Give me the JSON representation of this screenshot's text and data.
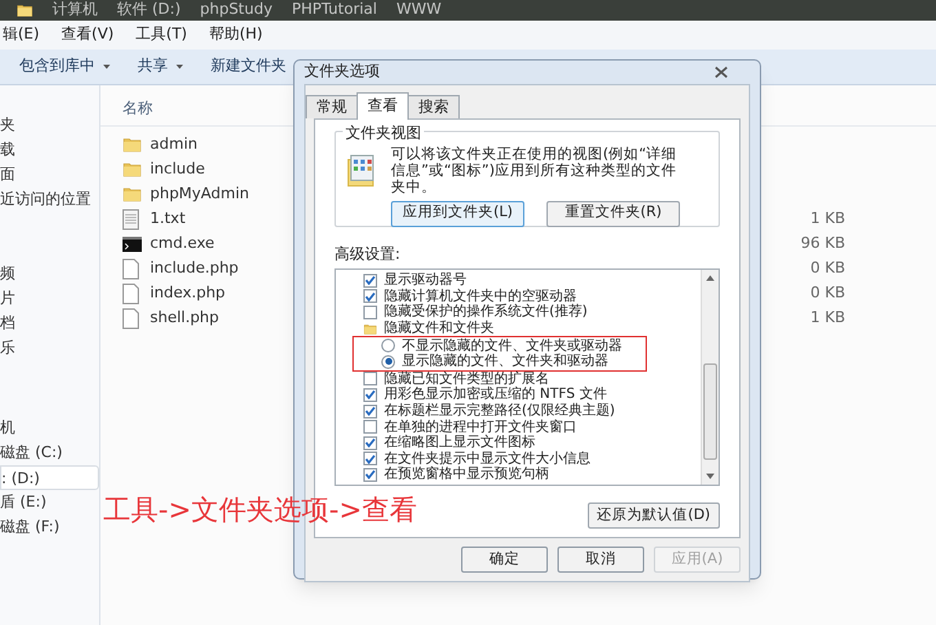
{
  "breadcrumb": [
    "计算机",
    "软件 (D:)",
    "phpStudy",
    "PHPTutorial",
    "WWW"
  ],
  "menu": [
    "辑(E)",
    "查看(V)",
    "工具(T)",
    "帮助(H)"
  ],
  "toolbar": [
    {
      "label": "包含到库中",
      "dropdown": true
    },
    {
      "label": "共享",
      "dropdown": true
    },
    {
      "label": "新建文件夹",
      "dropdown": false
    }
  ],
  "sidebar": {
    "items": [
      {
        "label": "夹",
        "selected": false
      },
      {
        "label": "载",
        "selected": false
      },
      {
        "label": "面",
        "selected": false
      },
      {
        "label": "近访问的位置",
        "selected": false
      },
      {
        "label": "频",
        "selected": false
      },
      {
        "label": "片",
        "selected": false
      },
      {
        "label": "档",
        "selected": false
      },
      {
        "label": "乐",
        "selected": false
      },
      {
        "label": "机",
        "selected": false
      },
      {
        "label": "磁盘 (C:)",
        "selected": false
      },
      {
        "label": ": (D:)",
        "selected": true
      },
      {
        "label": "盾 (E:)",
        "selected": false
      },
      {
        "label": "磁盘 (F:)",
        "selected": false
      }
    ]
  },
  "files": {
    "column": "名称",
    "rows": [
      {
        "name": "admin",
        "kind": "folder"
      },
      {
        "name": "include",
        "kind": "folder"
      },
      {
        "name": "phpMyAdmin",
        "kind": "folder"
      },
      {
        "name": "1.txt",
        "kind": "text",
        "size": "1 KB"
      },
      {
        "name": "cmd.exe",
        "kind": "console",
        "size": "96 KB"
      },
      {
        "name": "include.php",
        "kind": "file",
        "size": "0 KB"
      },
      {
        "name": "index.php",
        "kind": "file",
        "size": "0 KB"
      },
      {
        "name": "shell.php",
        "kind": "file",
        "size": "1 KB"
      }
    ]
  },
  "dialog": {
    "title": "文件夹选项",
    "tabs": [
      {
        "label": "常规",
        "selected": false
      },
      {
        "label": "查看",
        "selected": true
      },
      {
        "label": "搜索",
        "selected": false
      }
    ],
    "folder_views": {
      "title": "文件夹视图",
      "text": "可以将该文件夹正在使用的视图(例如“详细信息”或“图标”)应用到所有这种类型的文件夹中。",
      "buttons": [
        "应用到文件夹(L)",
        "重置文件夹(R)"
      ]
    },
    "advanced": {
      "label": "高级设置:",
      "items": [
        {
          "kind": "checkbox",
          "label": "显示驱动器号",
          "checked": true
        },
        {
          "kind": "checkbox",
          "label": "隐藏计算机文件夹中的空驱动器",
          "checked": true
        },
        {
          "kind": "checkbox",
          "label": "隐藏受保护的操作系统文件(推荐)",
          "checked": false
        },
        {
          "kind": "folder",
          "label": "隐藏文件和文件夹"
        },
        {
          "kind": "radio",
          "label": "不显示隐藏的文件、文件夹或驱动器",
          "selected": false
        },
        {
          "kind": "radio",
          "label": "显示隐藏的文件、文件夹和驱动器",
          "selected": true
        },
        {
          "kind": "checkbox",
          "label": "隐藏已知文件类型的扩展名",
          "checked": false
        },
        {
          "kind": "checkbox",
          "label": "用彩色显示加密或压缩的 NTFS 文件",
          "checked": true
        },
        {
          "kind": "checkbox",
          "label": "在标题栏显示完整路径(仅限经典主题)",
          "checked": true
        },
        {
          "kind": "checkbox",
          "label": "在单独的进程中打开文件夹窗口",
          "checked": false
        },
        {
          "kind": "checkbox",
          "label": "在缩略图上显示文件图标",
          "checked": true
        },
        {
          "kind": "checkbox",
          "label": "在文件夹提示中显示文件大小信息",
          "checked": true
        },
        {
          "kind": "checkbox",
          "label": "在预览窗格中显示预览句柄",
          "checked": true
        }
      ]
    },
    "restore_button": "还原为默认值(D)",
    "buttons": [
      {
        "label": "确定",
        "disabled": false
      },
      {
        "label": "取消",
        "disabled": false
      },
      {
        "label": "应用(A)",
        "disabled": true
      }
    ]
  },
  "annotation": "工具->文件夹选项->查看"
}
